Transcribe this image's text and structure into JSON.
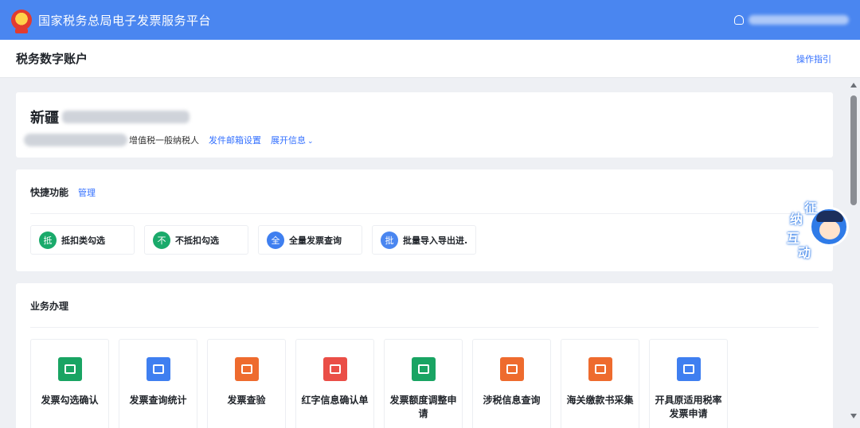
{
  "header": {
    "platform_title": "国家税务总局电子发票服务平台",
    "emblem_caption": "TAX"
  },
  "subheader": {
    "title": "税务数字账户",
    "guide_link": "操作指引"
  },
  "company": {
    "name_prefix": "新疆",
    "taxpayer_type": "增值税一般纳税人",
    "email_link": "发件邮箱设置",
    "expand_link": "展开信息",
    "expand_chevron": "⌄"
  },
  "quick_functions": {
    "title": "快捷功能",
    "manage_link": "管理",
    "items": [
      {
        "badge": "抵",
        "label": "抵扣类勾选",
        "color": "#1aaa6b"
      },
      {
        "badge": "不",
        "label": "不抵扣勾选",
        "color": "#1aaa6b"
      },
      {
        "badge": "全",
        "label": "全量发票查询",
        "color": "#3f7ff0"
      },
      {
        "badge": "批",
        "label": "批量导入导出进...",
        "color": "#4a86f0"
      }
    ]
  },
  "business": {
    "title": "业务办理",
    "items": [
      {
        "label": "发票勾选确认",
        "icon": "ticket-icon",
        "color": "#19a463"
      },
      {
        "label": "发票查询统计",
        "icon": "search-doc-icon",
        "color": "#3f7ff0"
      },
      {
        "label": "发票查验",
        "icon": "verify-ticket-icon",
        "color": "#ee6b2e"
      },
      {
        "label": "红字信息确认单",
        "icon": "red-doc-icon",
        "color": "#ea4e47"
      },
      {
        "label": "发票额度调整申请",
        "icon": "edit-doc-icon",
        "color": "#19a463"
      },
      {
        "label": "涉税信息查询",
        "icon": "folder-search-icon",
        "color": "#ee6b2e"
      },
      {
        "label": "海关缴款书采集",
        "icon": "customs-doc-icon",
        "color": "#ee6b2e"
      },
      {
        "label": "开具原适用税率发票申请",
        "icon": "clipboard-icon",
        "color": "#3f7ff0"
      }
    ]
  },
  "assistant": {
    "chars": [
      "征",
      "纳",
      "互",
      "动"
    ]
  }
}
